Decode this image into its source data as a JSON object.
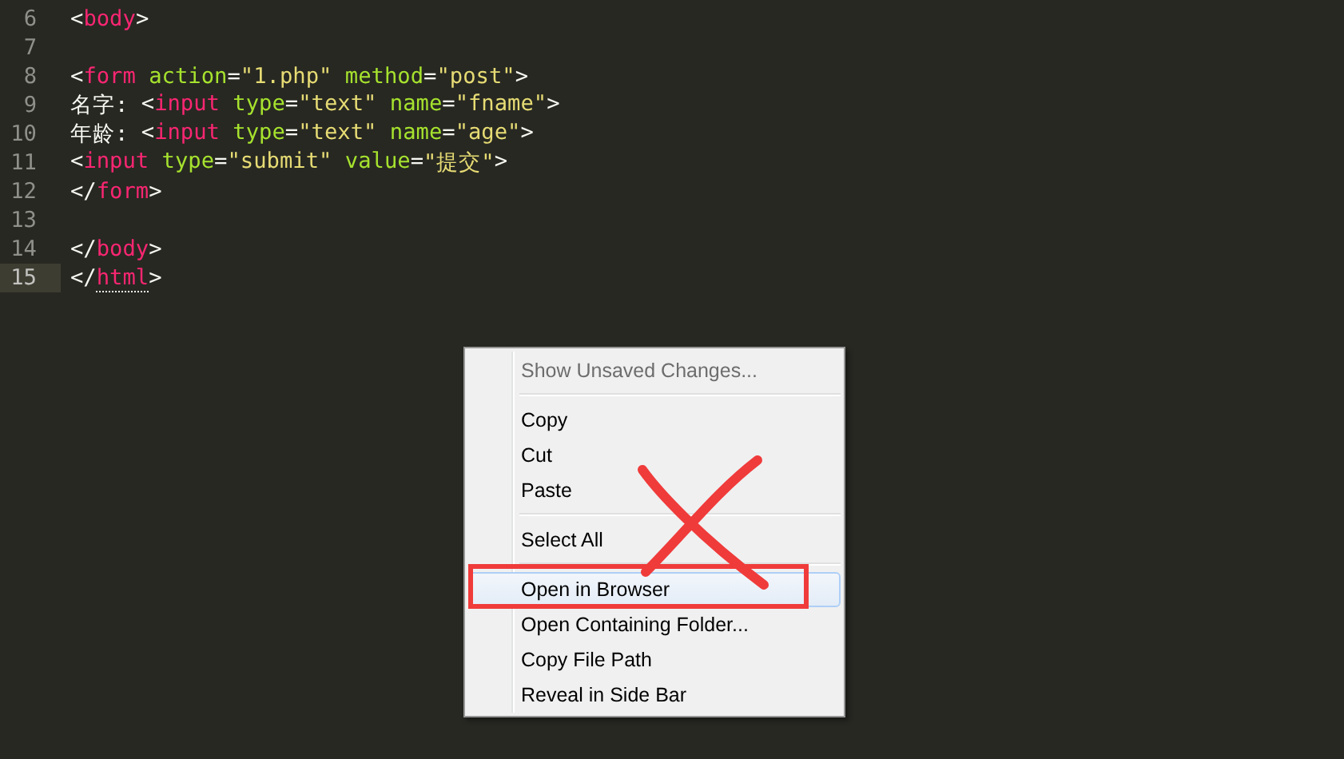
{
  "editor": {
    "lines": [
      {
        "number": "6",
        "current": false,
        "tokens": [
          {
            "kind": "punct",
            "text": "<"
          },
          {
            "kind": "tag",
            "text": "body"
          },
          {
            "kind": "punct",
            "text": ">"
          }
        ]
      },
      {
        "number": "7",
        "current": false
      },
      {
        "number": "8",
        "current": false,
        "tokens": [
          {
            "kind": "punct",
            "text": "<"
          },
          {
            "kind": "tag",
            "text": "form"
          },
          {
            "kind": "attr",
            "text": " action"
          },
          {
            "kind": "punct",
            "text": "="
          },
          {
            "kind": "string",
            "text": "\"1.php\""
          },
          {
            "kind": "attr",
            "text": " method"
          },
          {
            "kind": "punct",
            "text": "="
          },
          {
            "kind": "string",
            "text": "\"post\""
          },
          {
            "kind": "punct",
            "text": ">"
          }
        ]
      },
      {
        "number": "9",
        "current": false,
        "tokens": [
          {
            "kind": "plain",
            "text": "名字: "
          },
          {
            "kind": "punct",
            "text": "<"
          },
          {
            "kind": "tag",
            "text": "input"
          },
          {
            "kind": "attr",
            "text": " type"
          },
          {
            "kind": "punct",
            "text": "="
          },
          {
            "kind": "string",
            "text": "\"text\""
          },
          {
            "kind": "attr",
            "text": " name"
          },
          {
            "kind": "punct",
            "text": "="
          },
          {
            "kind": "string",
            "text": "\"fname\""
          },
          {
            "kind": "punct",
            "text": ">"
          }
        ]
      },
      {
        "number": "10",
        "current": false,
        "tokens": [
          {
            "kind": "plain",
            "text": "年龄: "
          },
          {
            "kind": "punct",
            "text": "<"
          },
          {
            "kind": "tag",
            "text": "input"
          },
          {
            "kind": "attr",
            "text": " type"
          },
          {
            "kind": "punct",
            "text": "="
          },
          {
            "kind": "string",
            "text": "\"text\""
          },
          {
            "kind": "attr",
            "text": " name"
          },
          {
            "kind": "punct",
            "text": "="
          },
          {
            "kind": "string",
            "text": "\"age\""
          },
          {
            "kind": "punct",
            "text": ">"
          }
        ]
      },
      {
        "number": "11",
        "current": false,
        "tokens": [
          {
            "kind": "punct",
            "text": "<"
          },
          {
            "kind": "tag",
            "text": "input"
          },
          {
            "kind": "attr",
            "text": " type"
          },
          {
            "kind": "punct",
            "text": "="
          },
          {
            "kind": "string",
            "text": "\"submit\""
          },
          {
            "kind": "attr",
            "text": " value"
          },
          {
            "kind": "punct",
            "text": "="
          },
          {
            "kind": "string",
            "text": "\"提交\""
          },
          {
            "kind": "punct",
            "text": ">"
          }
        ]
      },
      {
        "number": "12",
        "current": false,
        "tokens": [
          {
            "kind": "punct",
            "text": "</"
          },
          {
            "kind": "tag",
            "text": "form"
          },
          {
            "kind": "punct",
            "text": ">"
          }
        ]
      },
      {
        "number": "13",
        "current": false
      },
      {
        "number": "14",
        "current": false,
        "tokens": [
          {
            "kind": "punct",
            "text": "</"
          },
          {
            "kind": "tag",
            "text": "body"
          },
          {
            "kind": "punct",
            "text": ">"
          }
        ]
      },
      {
        "number": "15",
        "current": true,
        "tokens": [
          {
            "kind": "punct",
            "text": "</"
          },
          {
            "kind": "tag",
            "text": "html",
            "underline": true
          },
          {
            "kind": "punct",
            "text": ">"
          }
        ]
      }
    ]
  },
  "context_menu": {
    "items": [
      {
        "kind": "item",
        "label": "Show Unsaved Changes...",
        "disabled": true,
        "selected": false
      },
      {
        "kind": "separator"
      },
      {
        "kind": "item",
        "label": "Copy",
        "disabled": false,
        "selected": false
      },
      {
        "kind": "item",
        "label": "Cut",
        "disabled": false,
        "selected": false
      },
      {
        "kind": "item",
        "label": "Paste",
        "disabled": false,
        "selected": false
      },
      {
        "kind": "separator"
      },
      {
        "kind": "item",
        "label": "Select All",
        "disabled": false,
        "selected": false
      },
      {
        "kind": "separator"
      },
      {
        "kind": "item",
        "label": "Open in Browser",
        "disabled": false,
        "selected": true
      },
      {
        "kind": "item",
        "label": "Open Containing Folder...",
        "disabled": false,
        "selected": false
      },
      {
        "kind": "item",
        "label": "Copy File Path",
        "disabled": false,
        "selected": false
      },
      {
        "kind": "item",
        "label": "Reveal in Side Bar",
        "disabled": false,
        "selected": false
      }
    ]
  }
}
